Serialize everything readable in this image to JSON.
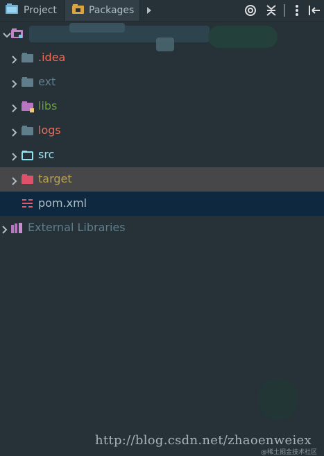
{
  "toolbar": {
    "tabs": [
      {
        "label": "Project",
        "icon": "project-window-icon"
      },
      {
        "label": "Packages",
        "icon": "packages-folder-icon"
      }
    ],
    "actions": [
      "more-tabs-icon",
      "locate-target-icon",
      "collapse-all-icon",
      "options-icon",
      "hide-panel-icon"
    ]
  },
  "tree": {
    "root": {
      "label": "",
      "icon": "module-folder-icon",
      "expanded": true
    },
    "items": [
      {
        "label": ".idea",
        "icon": "folder-icon",
        "color": "#ef6c57"
      },
      {
        "label": "ext",
        "icon": "folder-icon",
        "color": "#607d8b"
      },
      {
        "label": "libs",
        "icon": "library-folder-icon",
        "color": "#689f38"
      },
      {
        "label": "logs",
        "icon": "folder-icon",
        "color": "#ef6c57"
      },
      {
        "label": "src",
        "icon": "source-folder-icon",
        "color": "#8fe3f0"
      },
      {
        "label": "target",
        "icon": "excluded-folder-icon",
        "color": "#b8a14a"
      },
      {
        "label": "pom.xml",
        "icon": "maven-file-icon",
        "color": "#b0bec5"
      }
    ],
    "external": {
      "label": "External Libraries",
      "icon": "external-libraries-icon",
      "color": "#607d8b"
    }
  },
  "watermark": {
    "url": "http://blog.csdn.net/zhaoenweiex",
    "caption": "@稀土掘金技术社区"
  },
  "colors": {
    "background": "#263238",
    "selected_target": "#47474a",
    "selected_pom": "#0e293f"
  }
}
